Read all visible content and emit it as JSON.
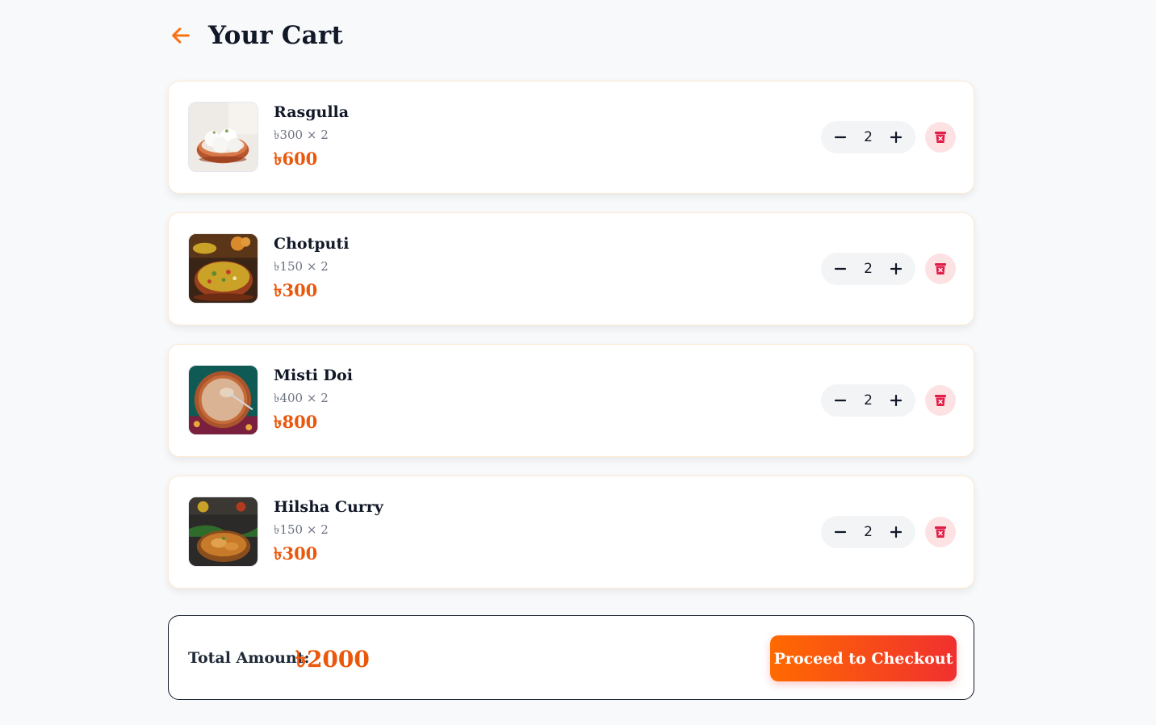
{
  "header": {
    "title": "Your Cart",
    "back_icon": "arrow-left-icon",
    "accent_color": "#f97316"
  },
  "items": [
    {
      "name": "Rasgulla",
      "unit": "৳300 × 2",
      "total": "৳600",
      "quantity": "2",
      "image_icon": "rasgulla-photo"
    },
    {
      "name": "Chotputi",
      "unit": "৳150 × 2",
      "total": "৳300",
      "quantity": "2",
      "image_icon": "chotputi-photo"
    },
    {
      "name": "Misti Doi",
      "unit": "৳400 × 2",
      "total": "৳800",
      "quantity": "2",
      "image_icon": "misti-doi-photo"
    },
    {
      "name": "Hilsha Curry",
      "unit": "৳150 × 2",
      "total": "৳300",
      "quantity": "2",
      "image_icon": "hilsha-curry-photo"
    }
  ],
  "controls": {
    "decrease_icon": "minus-icon",
    "increase_icon": "plus-icon",
    "delete_icon": "trash-icon",
    "delete_color": "#e11d48"
  },
  "summary": {
    "total_label": "Total Amount:",
    "total_value": "৳2000",
    "checkout_label": "Proceed to Checkout",
    "price_color": "#ea580c"
  }
}
